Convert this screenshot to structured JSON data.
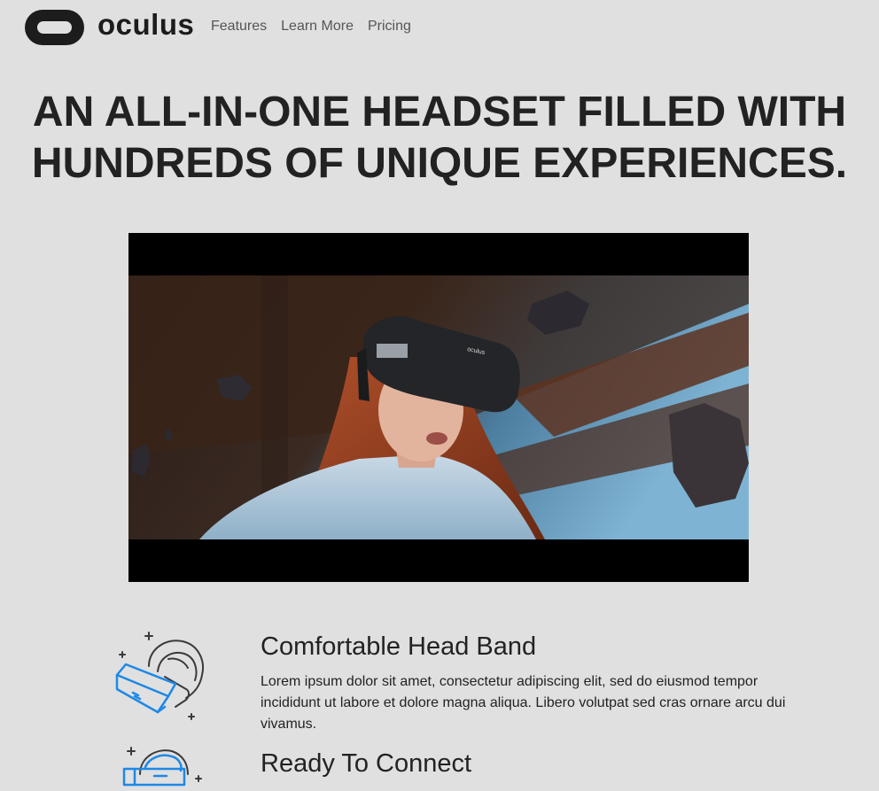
{
  "header": {
    "logo_text": "oculus",
    "nav": [
      {
        "label": "Features"
      },
      {
        "label": "Learn More"
      },
      {
        "label": "Pricing"
      }
    ]
  },
  "hero": {
    "title_line1": "AN ALL-IN-ONE HEADSET FILLED WITH",
    "title_line2": "HUNDREDS OF UNIQUE EXPERIENCES."
  },
  "video": {
    "headset_brand": "oculus"
  },
  "features": [
    {
      "title": "Comfortable Head Band",
      "description": "Lorem ipsum dolor sit amet, consectetur adipiscing elit, sed do eiusmod tempor incididunt ut labore et dolore magna aliqua. Libero volutpat sed cras ornare arcu dui vivamus.",
      "icon": "vr-headset-icon"
    },
    {
      "title": "Ready To Connect",
      "icon": "vr-connect-icon"
    }
  ],
  "colors": {
    "background": "#e0e0e0",
    "accent_blue": "#1e88e5",
    "text": "#222222"
  }
}
